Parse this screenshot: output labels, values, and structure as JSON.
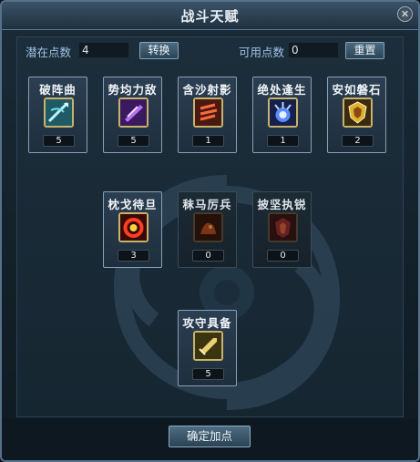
{
  "window": {
    "title": "战斗天赋",
    "close_glyph": "✕"
  },
  "points": {
    "potential_label": "潜在点数",
    "potential_value": "4",
    "convert_label": "转换",
    "available_label": "可用点数",
    "available_value": "0",
    "reset_label": "重置"
  },
  "talents": [
    {
      "name": "破阵曲",
      "count": "5",
      "icon": "spear-icon",
      "active": true
    },
    {
      "name": "势均力敌",
      "count": "5",
      "icon": "purple-blade-icon",
      "active": true
    },
    {
      "name": "含沙射影",
      "count": "1",
      "icon": "claw-strike-icon",
      "active": true
    },
    {
      "name": "绝处逢生",
      "count": "1",
      "icon": "blue-burst-icon",
      "active": true
    },
    {
      "name": "安如磐石",
      "count": "2",
      "icon": "shield-icon",
      "active": true
    },
    {
      "name": "枕戈待旦",
      "count": "3",
      "icon": "flame-ring-icon",
      "active": true
    },
    {
      "name": "秣马厉兵",
      "count": "0",
      "icon": "fire-beast-icon",
      "active": false
    },
    {
      "name": "披坚执锐",
      "count": "0",
      "icon": "armor-icon",
      "active": false
    },
    {
      "name": "攻守具备",
      "count": "5",
      "icon": "sword-shield-icon",
      "active": true
    }
  ],
  "footer": {
    "confirm_label": "确定加点"
  },
  "colors": {
    "accent": "#9fc2e6",
    "frame_gold": "#c9b26a",
    "panel_bg": "#1c2e3b"
  }
}
